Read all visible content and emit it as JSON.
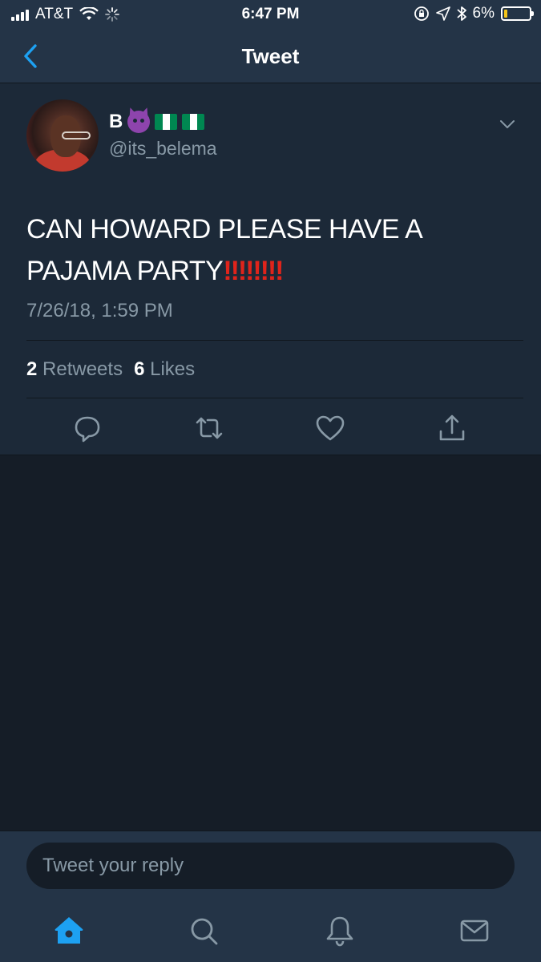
{
  "status_bar": {
    "carrier": "AT&T",
    "time": "6:47 PM",
    "battery": "6%",
    "battery_level": 0.06
  },
  "nav": {
    "title": "Tweet"
  },
  "tweet": {
    "author_name": "B",
    "author_handle": "@its_belema",
    "text": "CAN HOWARD PLEASE HAVE A PAJAMA PARTY",
    "emphasis": "‼‼‼‼",
    "timestamp": "7/26/18, 1:59 PM",
    "retweets_count": "2",
    "retweets_label": "Retweets",
    "likes_count": "6",
    "likes_label": "Likes"
  },
  "composer": {
    "placeholder": "Tweet your reply"
  },
  "icons": {
    "back": "chevron-left-icon",
    "caret": "chevron-down-icon",
    "reply": "comment-icon",
    "retweet": "retweet-icon",
    "like": "heart-icon",
    "share": "share-icon",
    "home": "home-icon",
    "search": "search-icon",
    "notifications": "bell-icon",
    "messages": "mail-icon"
  },
  "colors": {
    "accent": "#1da1f2",
    "background": "#151d27",
    "card": "#1c2938",
    "bar": "#243447",
    "muted": "#8899a6"
  }
}
